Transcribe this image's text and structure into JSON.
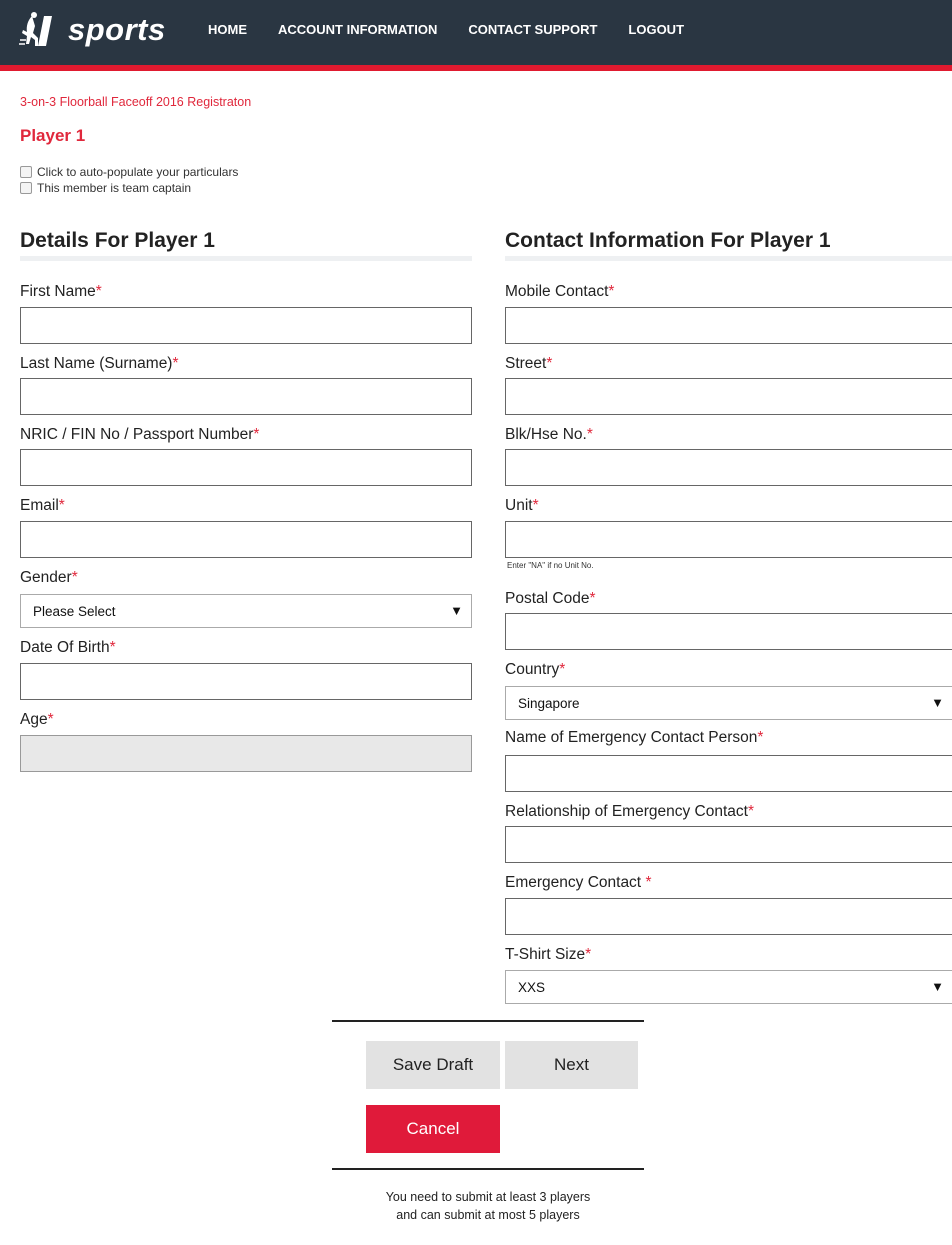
{
  "header": {
    "logo_text": "sports",
    "nav": [
      "HOME",
      "ACCOUNT INFORMATION",
      "CONTACT SUPPORT",
      "LOGOUT"
    ]
  },
  "breadcrumb": "3-on-3 Floorball Faceoff 2016 Registraton",
  "player_heading": "Player 1",
  "checkboxes": [
    {
      "label": "Click to auto-populate your particulars",
      "checked": false
    },
    {
      "label": "This member is team captain",
      "checked": false
    }
  ],
  "details": {
    "title": "Details For Player 1",
    "first_name": {
      "label": "First Name",
      "value": ""
    },
    "last_name": {
      "label": "Last Name (Surname)",
      "value": ""
    },
    "nric": {
      "label": "NRIC / FIN No / Passport Number",
      "value": ""
    },
    "email": {
      "label": "Email",
      "value": ""
    },
    "gender": {
      "label": "Gender",
      "selected": "Please Select"
    },
    "dob": {
      "label": "Date Of Birth",
      "value": ""
    },
    "age": {
      "label": "Age",
      "value": ""
    }
  },
  "contact": {
    "title": "Contact Information For Player 1",
    "mobile": {
      "label": "Mobile Contact",
      "value": ""
    },
    "street": {
      "label": "Street",
      "value": ""
    },
    "blk": {
      "label": "Blk/Hse No.",
      "value": ""
    },
    "unit": {
      "label": "Unit",
      "value": "",
      "hint": "Enter \"NA\" if no Unit No."
    },
    "postal": {
      "label": "Postal Code",
      "value": ""
    },
    "country": {
      "label": "Country",
      "selected": "Singapore"
    },
    "emergency_name": {
      "label": "Name of Emergency Contact Person",
      "value": ""
    },
    "emergency_relationship": {
      "label": "Relationship of Emergency Contact",
      "value": ""
    },
    "emergency_contact": {
      "label": "Emergency Contact ",
      "value": ""
    },
    "tshirt": {
      "label": "T-Shirt Size",
      "selected": "XXS"
    }
  },
  "required_marker": "*",
  "select_arrow": "▼",
  "actions": {
    "save_draft": "Save Draft",
    "next": "Next",
    "cancel": "Cancel"
  },
  "footnote": {
    "line1": "You need to submit at least 3 players",
    "line2": "and can submit at most 5 players"
  },
  "colors": {
    "header_bg": "#2a3642",
    "accent_red": "#e01a2f",
    "button_grey": "#e2e2e2"
  }
}
